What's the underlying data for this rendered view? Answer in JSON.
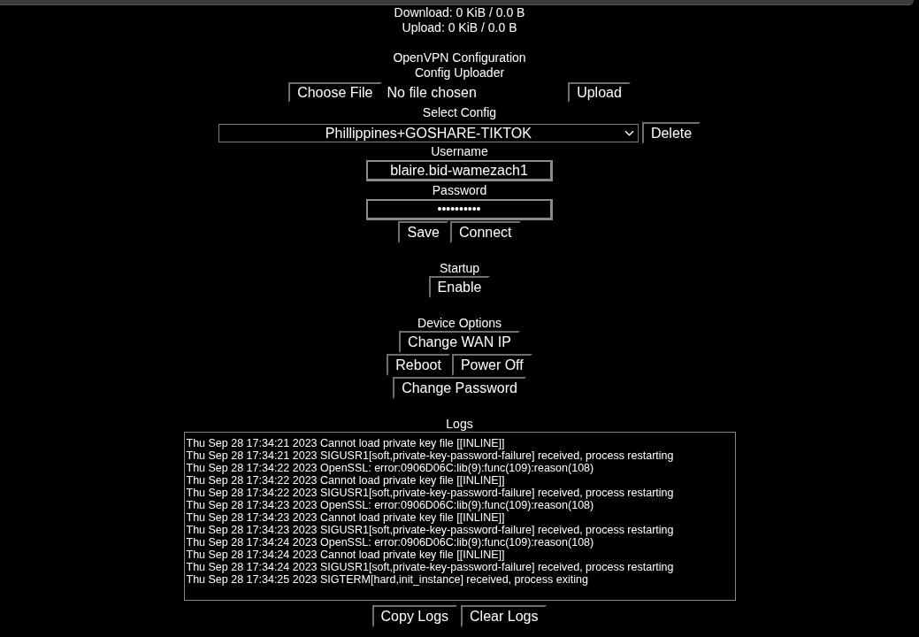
{
  "stats": [
    "Download: 0 KiB / 0.0 B",
    "Upload: 0 KiB / 0.0 B"
  ],
  "openvpn": {
    "heading": "OpenVPN Configuration",
    "uploader": {
      "label": "Config Uploader",
      "choose_button": "Choose File",
      "file_status": "No file chosen",
      "upload_button": "Upload"
    },
    "select": {
      "label": "Select Config",
      "value": "Phillippines+GOSHARE-TIKTOK",
      "delete_button": "Delete"
    },
    "username": {
      "label": "Username",
      "value": "blaire.bid-wamezach1"
    },
    "password": {
      "label": "Password",
      "value": "••••••••••"
    },
    "save_button": "Save",
    "connect_button": "Connect"
  },
  "startup": {
    "label": "Startup",
    "enable_button": "Enable"
  },
  "device_options": {
    "label": "Device Options",
    "change_wan_ip_button": "Change WAN IP",
    "reboot_button": "Reboot",
    "power_off_button": "Power Off",
    "change_password_button": "Change Password"
  },
  "logs": {
    "label": "Logs",
    "lines": [
      "Thu Sep 28 17:34:21 2023 Cannot load private key file [[INLINE]]",
      "Thu Sep 28 17:34:21 2023 SIGUSR1[soft,private-key-password-failure] received, process restarting",
      "Thu Sep 28 17:34:22 2023 OpenSSL: error:0906D06C:lib(9):func(109):reason(108)",
      "Thu Sep 28 17:34:22 2023 Cannot load private key file [[INLINE]]",
      "Thu Sep 28 17:34:22 2023 SIGUSR1[soft,private-key-password-failure] received, process restarting",
      "Thu Sep 28 17:34:23 2023 OpenSSL: error:0906D06C:lib(9):func(109):reason(108)",
      "Thu Sep 28 17:34:23 2023 Cannot load private key file [[INLINE]]",
      "Thu Sep 28 17:34:23 2023 SIGUSR1[soft,private-key-password-failure] received, process restarting",
      "Thu Sep 28 17:34:24 2023 OpenSSL: error:0906D06C:lib(9):func(109):reason(108)",
      "Thu Sep 28 17:34:24 2023 Cannot load private key file [[INLINE]]",
      "Thu Sep 28 17:34:24 2023 SIGUSR1[soft,private-key-password-failure] received, process restarting",
      "Thu Sep 28 17:34:25 2023 SIGTERM[hard,init_instance] received, process exiting"
    ],
    "copy_button": "Copy Logs",
    "clear_button": "Clear Logs"
  }
}
